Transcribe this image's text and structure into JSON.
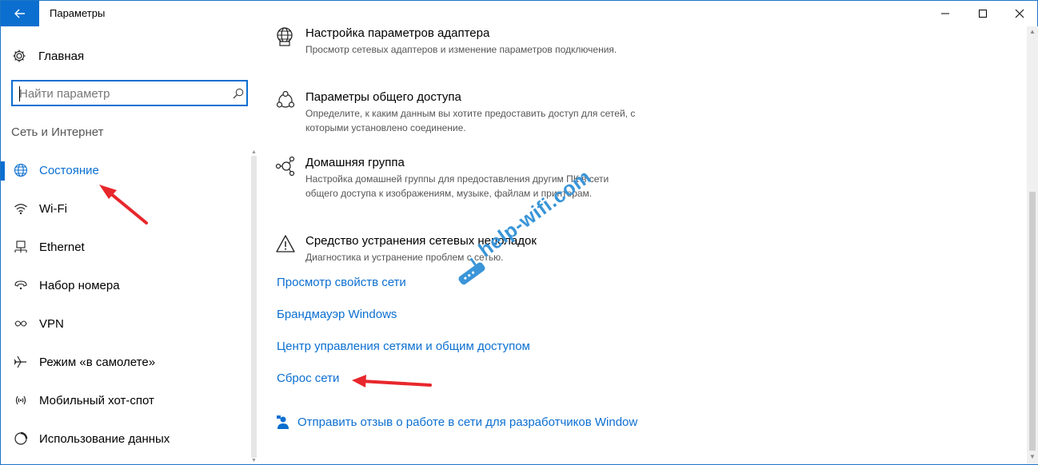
{
  "window": {
    "title": "Параметры",
    "back_icon": "back-arrow-icon",
    "controls": [
      "minimize",
      "maximize",
      "close"
    ]
  },
  "sidebar": {
    "home": {
      "label": "Главная",
      "icon": "gear-icon"
    },
    "search": {
      "placeholder": "Найти параметр",
      "icon": "search-icon"
    },
    "section_heading": "Сеть и Интернет",
    "items": [
      {
        "label": "Состояние",
        "icon": "globe-icon",
        "active": true
      },
      {
        "label": "Wi-Fi",
        "icon": "wifi-icon"
      },
      {
        "label": "Ethernet",
        "icon": "ethernet-icon"
      },
      {
        "label": "Набор номера",
        "icon": "dialup-icon"
      },
      {
        "label": "VPN",
        "icon": "vpn-icon"
      },
      {
        "label": "Режим «в самолете»",
        "icon": "airplane-icon"
      },
      {
        "label": "Мобильный хот-спот",
        "icon": "hotspot-icon"
      },
      {
        "label": "Использование данных",
        "icon": "data-usage-icon"
      }
    ]
  },
  "main": {
    "entries": [
      {
        "title": "Настройка параметров адаптера",
        "description": "Просмотр сетевых адаптеров и изменение параметров подключения.",
        "icon": "adapter-globe-icon"
      },
      {
        "title": "Параметры общего доступа",
        "description": "Определите, к каким данным вы хотите предоставить доступ для сетей, с которыми установлено соединение.",
        "icon": "sharing-icon"
      },
      {
        "title": "Домашняя группа",
        "description": "Настройка домашней группы для предоставления другим ПК в сети общего доступа к изображениям, музыке, файлам и принтерам.",
        "icon": "homegroup-icon"
      },
      {
        "title": "Средство устранения сетевых неполадок",
        "description": "Диагностика и устранение проблем с сетью.",
        "icon": "warning-icon"
      }
    ],
    "links": [
      "Просмотр свойств сети",
      "Брандмауэр Windows",
      "Центр управления сетями и общим доступом",
      "Сброс сети"
    ],
    "feedback": {
      "label": "Отправить отзыв о работе в сети для разработчиков Window",
      "icon": "feedback-person-icon"
    }
  },
  "watermark": {
    "text": "help-wifi.com",
    "color": "#3a95d8"
  },
  "colors": {
    "accent": "#0b6fd0",
    "annotation_arrow": "#e8272c"
  }
}
